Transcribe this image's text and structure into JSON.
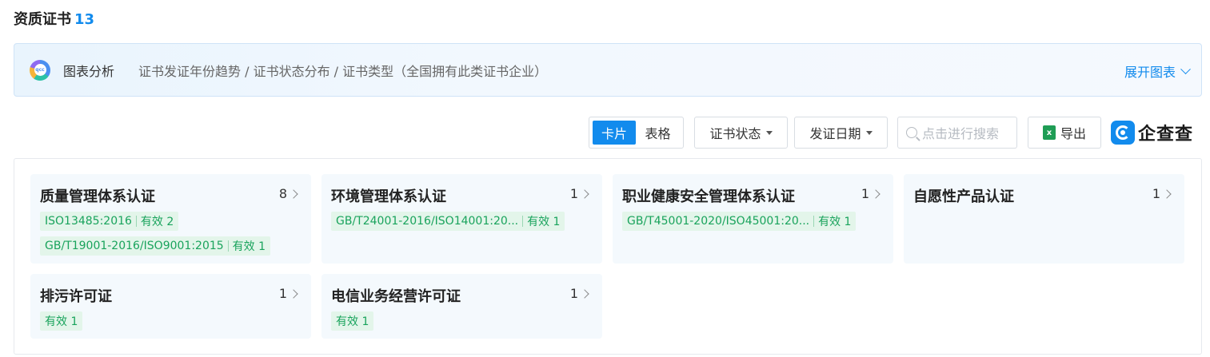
{
  "section": {
    "title": "资质证书",
    "count": "13"
  },
  "chart_banner": {
    "icon": "pie-chart-logo-icon",
    "label": "图表分析",
    "description": "证书发证年份趋势 / 证书状态分布 / 证书类型（全国拥有此类证书企业）",
    "expand_label": "展开图表"
  },
  "toolbar": {
    "view_card": "卡片",
    "view_table": "表格",
    "status_filter": "证书状态",
    "date_filter": "发证日期",
    "search_placeholder": "点击进行搜索",
    "export_label": "导出",
    "brand_text": "企查查"
  },
  "cards": [
    {
      "title": "质量管理体系认证",
      "count": "8",
      "tags": [
        {
          "code": "ISO13485:2016",
          "status": "有效 2"
        },
        {
          "code": "GB/T19001-2016/ISO9001:2015",
          "status": "有效 1"
        }
      ]
    },
    {
      "title": "环境管理体系认证",
      "count": "1",
      "tags": [
        {
          "code": "GB/T24001-2016/ISO14001:20...",
          "status": "有效 1"
        }
      ]
    },
    {
      "title": "职业健康安全管理体系认证",
      "count": "1",
      "tags": [
        {
          "code": "GB/T45001-2020/ISO45001:20...",
          "status": "有效 1"
        }
      ]
    },
    {
      "title": "自愿性产品认证",
      "count": "1",
      "tags": []
    },
    {
      "title": "排污许可证",
      "count": "1",
      "tags": [
        {
          "code": "",
          "status": "有效 1"
        }
      ]
    },
    {
      "title": "电信业务经营许可证",
      "count": "1",
      "tags": [
        {
          "code": "",
          "status": "有效 1"
        }
      ]
    }
  ],
  "colors": {
    "accent": "#128bed",
    "valid_green": "#19a35c",
    "card_bg": "#f4f9fd"
  }
}
